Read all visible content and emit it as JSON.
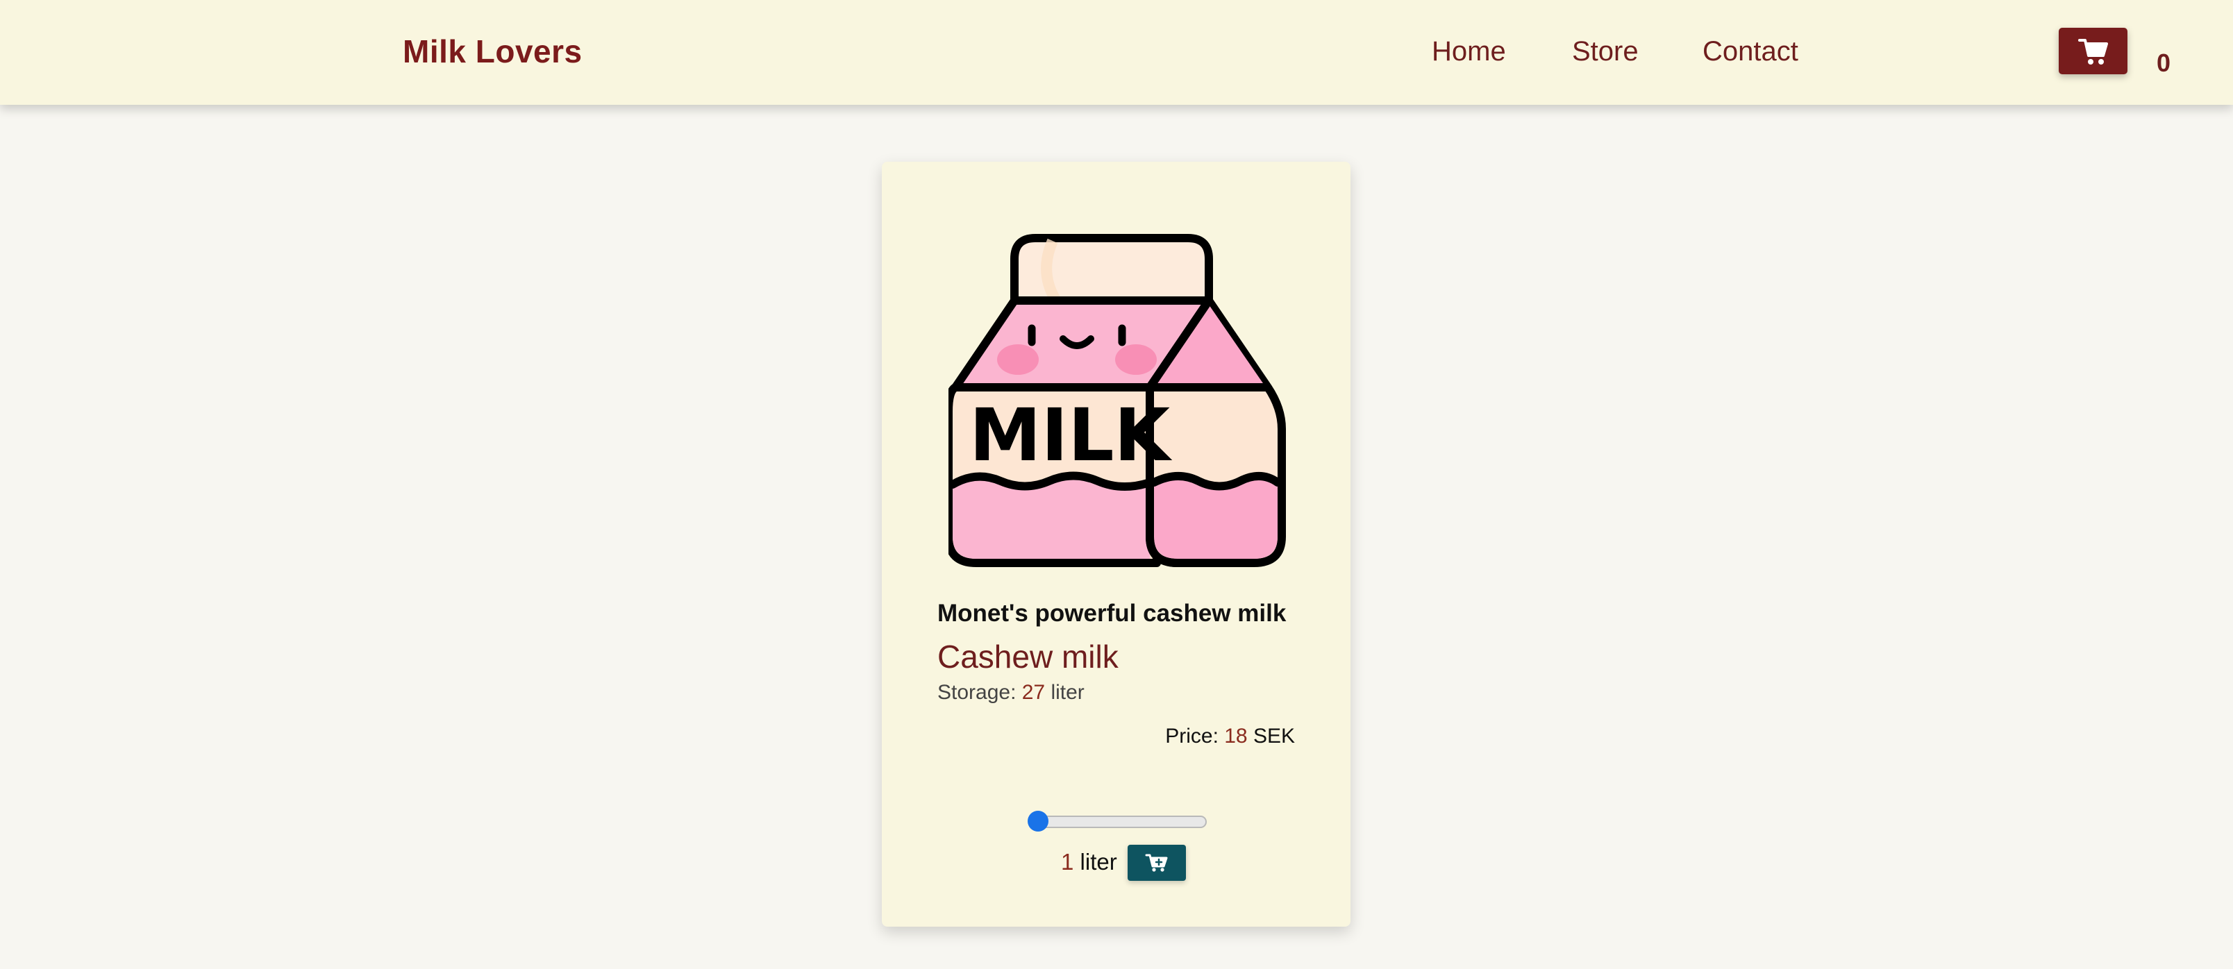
{
  "header": {
    "brand": "Milk Lovers",
    "nav": {
      "home": "Home",
      "store": "Store",
      "contact": "Contact"
    },
    "cart_icon": "shopping-cart-icon",
    "cart_count": "0"
  },
  "product": {
    "image_icon": "milk-carton-icon",
    "image_text": "MILK",
    "name": "Monet's powerful cashew milk",
    "type": "Cashew milk",
    "storage_label": "Storage: ",
    "storage_value": "27",
    "storage_unit": " liter",
    "price_label": "Price: ",
    "price_value": "18",
    "price_unit": " SEK",
    "quantity_value": "1",
    "quantity_unit": " liter",
    "quantity_fraction": 0.0,
    "add_to_cart_icon": "add-to-cart-icon"
  },
  "colors": {
    "brand": "#7b1b1b",
    "navbar_bg": "#f9f6df",
    "page_bg": "#f7f6f1",
    "card_bg": "#f9f6df",
    "accent": "#8a2b1e",
    "add_button": "#0e5460",
    "slider_thumb": "#1a73e8"
  }
}
